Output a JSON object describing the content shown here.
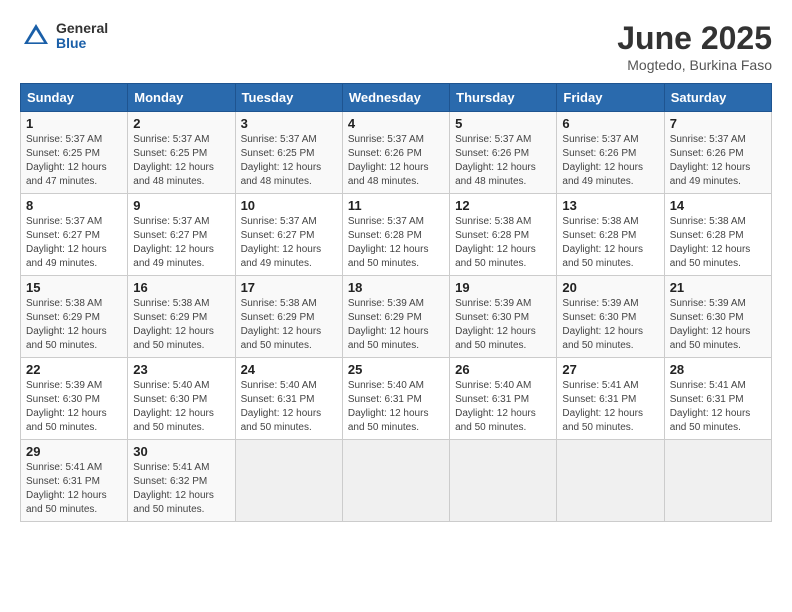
{
  "header": {
    "logo_general": "General",
    "logo_blue": "Blue",
    "month_title": "June 2025",
    "location": "Mogtedo, Burkina Faso"
  },
  "calendar": {
    "days_of_week": [
      "Sunday",
      "Monday",
      "Tuesday",
      "Wednesday",
      "Thursday",
      "Friday",
      "Saturday"
    ],
    "weeks": [
      [
        null,
        {
          "day": 2,
          "sunrise": "5:37 AM",
          "sunset": "6:25 PM",
          "daylight": "12 hours and 48 minutes."
        },
        {
          "day": 3,
          "sunrise": "5:37 AM",
          "sunset": "6:25 PM",
          "daylight": "12 hours and 48 minutes."
        },
        {
          "day": 4,
          "sunrise": "5:37 AM",
          "sunset": "6:26 PM",
          "daylight": "12 hours and 48 minutes."
        },
        {
          "day": 5,
          "sunrise": "5:37 AM",
          "sunset": "6:26 PM",
          "daylight": "12 hours and 48 minutes."
        },
        {
          "day": 6,
          "sunrise": "5:37 AM",
          "sunset": "6:26 PM",
          "daylight": "12 hours and 49 minutes."
        },
        {
          "day": 7,
          "sunrise": "5:37 AM",
          "sunset": "6:26 PM",
          "daylight": "12 hours and 49 minutes."
        }
      ],
      [
        {
          "day": 1,
          "sunrise": "5:37 AM",
          "sunset": "6:25 PM",
          "daylight": "12 hours and 47 minutes."
        },
        {
          "day": 9,
          "sunrise": "5:37 AM",
          "sunset": "6:27 PM",
          "daylight": "12 hours and 49 minutes."
        },
        {
          "day": 10,
          "sunrise": "5:37 AM",
          "sunset": "6:27 PM",
          "daylight": "12 hours and 49 minutes."
        },
        {
          "day": 11,
          "sunrise": "5:37 AM",
          "sunset": "6:28 PM",
          "daylight": "12 hours and 50 minutes."
        },
        {
          "day": 12,
          "sunrise": "5:38 AM",
          "sunset": "6:28 PM",
          "daylight": "12 hours and 50 minutes."
        },
        {
          "day": 13,
          "sunrise": "5:38 AM",
          "sunset": "6:28 PM",
          "daylight": "12 hours and 50 minutes."
        },
        {
          "day": 14,
          "sunrise": "5:38 AM",
          "sunset": "6:28 PM",
          "daylight": "12 hours and 50 minutes."
        }
      ],
      [
        {
          "day": 8,
          "sunrise": "5:37 AM",
          "sunset": "6:27 PM",
          "daylight": "12 hours and 49 minutes."
        },
        {
          "day": 16,
          "sunrise": "5:38 AM",
          "sunset": "6:29 PM",
          "daylight": "12 hours and 50 minutes."
        },
        {
          "day": 17,
          "sunrise": "5:38 AM",
          "sunset": "6:29 PM",
          "daylight": "12 hours and 50 minutes."
        },
        {
          "day": 18,
          "sunrise": "5:39 AM",
          "sunset": "6:29 PM",
          "daylight": "12 hours and 50 minutes."
        },
        {
          "day": 19,
          "sunrise": "5:39 AM",
          "sunset": "6:30 PM",
          "daylight": "12 hours and 50 minutes."
        },
        {
          "day": 20,
          "sunrise": "5:39 AM",
          "sunset": "6:30 PM",
          "daylight": "12 hours and 50 minutes."
        },
        {
          "day": 21,
          "sunrise": "5:39 AM",
          "sunset": "6:30 PM",
          "daylight": "12 hours and 50 minutes."
        }
      ],
      [
        {
          "day": 15,
          "sunrise": "5:38 AM",
          "sunset": "6:29 PM",
          "daylight": "12 hours and 50 minutes."
        },
        {
          "day": 23,
          "sunrise": "5:40 AM",
          "sunset": "6:30 PM",
          "daylight": "12 hours and 50 minutes."
        },
        {
          "day": 24,
          "sunrise": "5:40 AM",
          "sunset": "6:31 PM",
          "daylight": "12 hours and 50 minutes."
        },
        {
          "day": 25,
          "sunrise": "5:40 AM",
          "sunset": "6:31 PM",
          "daylight": "12 hours and 50 minutes."
        },
        {
          "day": 26,
          "sunrise": "5:40 AM",
          "sunset": "6:31 PM",
          "daylight": "12 hours and 50 minutes."
        },
        {
          "day": 27,
          "sunrise": "5:41 AM",
          "sunset": "6:31 PM",
          "daylight": "12 hours and 50 minutes."
        },
        {
          "day": 28,
          "sunrise": "5:41 AM",
          "sunset": "6:31 PM",
          "daylight": "12 hours and 50 minutes."
        }
      ],
      [
        {
          "day": 22,
          "sunrise": "5:39 AM",
          "sunset": "6:30 PM",
          "daylight": "12 hours and 50 minutes."
        },
        {
          "day": 30,
          "sunrise": "5:41 AM",
          "sunset": "6:32 PM",
          "daylight": "12 hours and 50 minutes."
        },
        null,
        null,
        null,
        null,
        null
      ],
      [
        {
          "day": 29,
          "sunrise": "5:41 AM",
          "sunset": "6:31 PM",
          "daylight": "12 hours and 50 minutes."
        },
        null,
        null,
        null,
        null,
        null,
        null
      ]
    ]
  }
}
